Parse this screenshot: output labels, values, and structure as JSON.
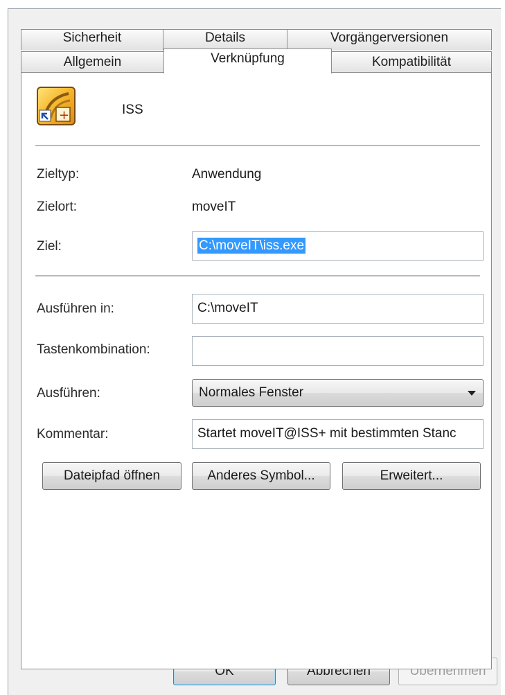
{
  "tabs": {
    "row1": [
      {
        "label": "Sicherheit"
      },
      {
        "label": "Details"
      },
      {
        "label": "Vorgängerversionen"
      }
    ],
    "row2": [
      {
        "label": "Allgemein"
      },
      {
        "label": "Verknüpfung",
        "active": true
      },
      {
        "label": "Kompatibilität"
      }
    ]
  },
  "shortcut": {
    "name": "ISS",
    "icon": "iss-shortcut-icon"
  },
  "fields": {
    "zieltyp": {
      "label": "Zieltyp:",
      "value": "Anwendung"
    },
    "zielort": {
      "label": "Zielort:",
      "value": "moveIT"
    },
    "ziel": {
      "label": "Ziel:",
      "value": "C:\\moveIT\\iss.exe"
    },
    "ausfuehren_in": {
      "label": "Ausführen in:",
      "value": "C:\\moveIT"
    },
    "tastenkombination": {
      "label": "Tastenkombination:",
      "value": ""
    },
    "ausfuehren": {
      "label": "Ausführen:",
      "value": "Normales Fenster"
    },
    "kommentar": {
      "label": "Kommentar:",
      "value": "Startet moveIT@ISS+ mit bestimmten Stanc"
    }
  },
  "buttons": {
    "dateipfad": "Dateipfad öffnen",
    "anderes_symbol": "Anderes Symbol...",
    "erweitert": "Erweitert...",
    "ok": "OK",
    "abbrechen": "Abbrechen",
    "uebernehmen": "Übernehmen"
  },
  "colors": {
    "selection": "#3399ff",
    "default_button_border": "#3c7fb1"
  }
}
